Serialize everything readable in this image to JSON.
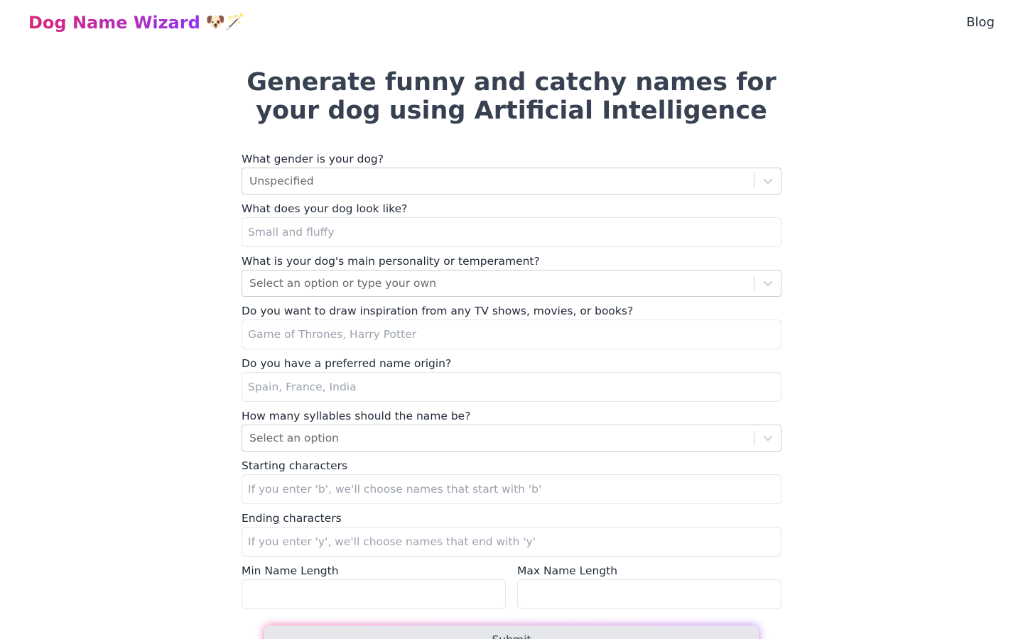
{
  "header": {
    "logo_text": "Dog Name Wizard",
    "logo_emoji": "🐶🪄",
    "blog_link": "Blog"
  },
  "hero": {
    "title_line1": "Generate funny and catchy names for",
    "title_line2": "your dog using Artificial Intelligence"
  },
  "form": {
    "gender": {
      "label": "What gender is your dog?",
      "value": "Unspecified"
    },
    "appearance": {
      "label": "What does your dog look like?",
      "placeholder": "Small and fluffy"
    },
    "personality": {
      "label": "What is your dog's main personality or temperament?",
      "placeholder": "Select an option or type your own"
    },
    "inspiration": {
      "label": "Do you want to draw inspiration from any TV shows, movies, or books?",
      "placeholder": "Game of Thrones, Harry Potter"
    },
    "origin": {
      "label": "Do you have a preferred name origin?",
      "placeholder": "Spain, France, India"
    },
    "syllables": {
      "label": "How many syllables should the name be?",
      "placeholder": "Select an option"
    },
    "starting": {
      "label": "Starting characters",
      "placeholder": "If you enter 'b', we'll choose names that start with 'b'"
    },
    "ending": {
      "label": "Ending characters",
      "placeholder": "If you enter 'y', we'll choose names that end with 'y'"
    },
    "min_length": {
      "label": "Min Name Length",
      "value": ""
    },
    "max_length": {
      "label": "Max Name Length",
      "value": ""
    },
    "submit_label": "Submit"
  },
  "colors": {
    "brand_gradient_start": "#db2777",
    "brand_gradient_end": "#9333ea",
    "heading": "#374151",
    "input_border": "#e5e7eb",
    "select_border": "#cccccc"
  },
  "icons": {
    "select_indicator": "chevron-down-icon"
  }
}
